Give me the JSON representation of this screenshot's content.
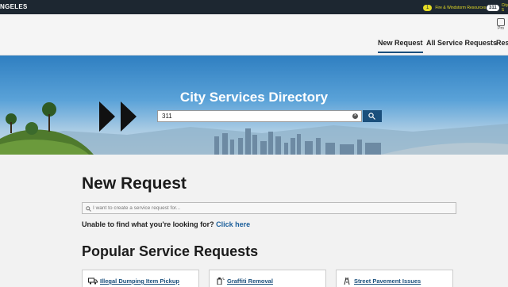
{
  "topbar": {
    "brand": "NGELES",
    "fire_badge": "1",
    "fire_label": "Fire & Windstorm Resources",
    "city_badge": "311",
    "city_label": "City S"
  },
  "profile": {
    "label": "Pro"
  },
  "nav": {
    "tabs": [
      {
        "label": "New Request",
        "active": true
      },
      {
        "label": "All Service Requests",
        "active": false
      },
      {
        "label": "Reso",
        "active": false
      }
    ]
  },
  "hero": {
    "title": "City Services Directory",
    "search_value": "311",
    "clear_glyph": "×"
  },
  "main": {
    "heading": "New Request",
    "request_placeholder": "I want to create a service request for...",
    "unable_text": "Unable to find what you're looking for?",
    "unable_link": "Click here",
    "popular_heading": "Popular Service Requests",
    "cards": [
      {
        "label": "Illegal Dumping Item Pickup",
        "icon": "truck-icon"
      },
      {
        "label": "Graffiti Removal",
        "icon": "spray-can-icon"
      },
      {
        "label": "Street Pavement Issues",
        "icon": "road-icon"
      }
    ]
  },
  "colors": {
    "topbar": "#1d2731",
    "accent": "#1a4f7c",
    "badge_yellow": "#e5dc25",
    "link": "#1a5e9a"
  }
}
